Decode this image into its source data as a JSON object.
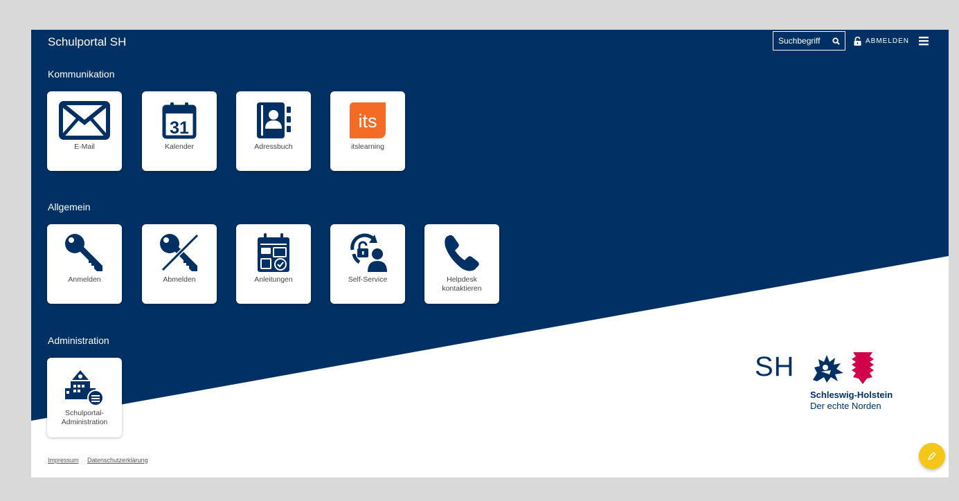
{
  "header": {
    "brand": "Schulportal SH",
    "search_placeholder": "Suchbegriff",
    "logout_label": "ABMELDEN"
  },
  "sections": [
    {
      "title": "Kommunikation",
      "tiles": [
        {
          "label": "E-Mail",
          "icon": "mail-icon"
        },
        {
          "label": "Kalender",
          "icon": "calendar-icon"
        },
        {
          "label": "Adressbuch",
          "icon": "address-book-icon"
        },
        {
          "label": "itslearning",
          "icon": "itslearning-logo",
          "logo_text": "its"
        }
      ]
    },
    {
      "title": "Allgemein",
      "tiles": [
        {
          "label": "Anmelden",
          "icon": "key-icon"
        },
        {
          "label": "Abmelden",
          "icon": "key-crossed-icon"
        },
        {
          "label": "Anleitungen",
          "icon": "guides-icon"
        },
        {
          "label": "Self-Service",
          "icon": "self-service-icon"
        },
        {
          "label": "Helpdesk kontaktieren",
          "icon": "phone-icon"
        }
      ]
    },
    {
      "title": "Administration",
      "tiles": [
        {
          "label": "Schulportal-Administration",
          "icon": "school-admin-icon"
        }
      ]
    }
  ],
  "logo": {
    "letters": "SH",
    "line1": "Schleswig-Holstein",
    "line2": "Der echte Norden"
  },
  "footer": {
    "impressum": "Impressum",
    "datenschutz": "Datenschutzerklärung"
  },
  "colors": {
    "navy": "#003064",
    "accent_orange": "#f36b24",
    "fab_yellow": "#f5c518",
    "logo_red": "#d2004b"
  },
  "calendar_day": "31"
}
